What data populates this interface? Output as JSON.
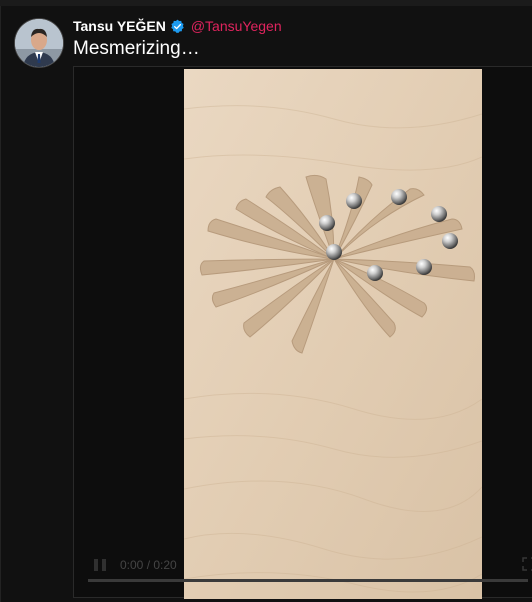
{
  "tweet": {
    "author_name": "Tansu YEĞEN",
    "handle": "@TansuYegen",
    "text": "Mesmerizing…",
    "verified": true
  },
  "video": {
    "time": "0:00 / 0:20",
    "progress": 0.0,
    "subject": "wooden spiral marble track with steel balls"
  },
  "icons": {
    "verified": "verified-badge-icon",
    "play": "play-icon",
    "fullscreen": "fullscreen-icon"
  },
  "colors": {
    "background": "#111111",
    "handle": "#e0245e",
    "verified": "#1d9bf0",
    "wood": "#e3cfb6"
  }
}
